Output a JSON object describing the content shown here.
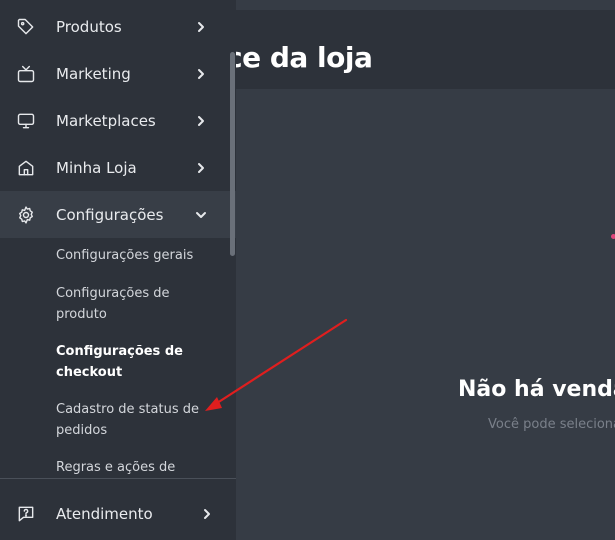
{
  "main": {
    "title": "ce da loja",
    "empty_title": "Não há vendas",
    "empty_subtitle": "Você pode seleciona"
  },
  "sidebar": {
    "items": [
      {
        "label": "Produtos",
        "icon": "tag-icon"
      },
      {
        "label": "Marketing",
        "icon": "tv-icon"
      },
      {
        "label": "Marketplaces",
        "icon": "monitor-icon"
      },
      {
        "label": "Minha Loja",
        "icon": "home-icon"
      },
      {
        "label": "Configurações",
        "icon": "gear-icon",
        "expanded": true
      }
    ],
    "subitems": [
      {
        "label": "Configurações gerais"
      },
      {
        "label": "Configurações de produto"
      },
      {
        "label": "Configurações de checkout",
        "current": true
      },
      {
        "label": "Cadastro de status de pedidos"
      },
      {
        "label": "Regras e ações de"
      }
    ],
    "footer_item": {
      "label": "Atendimento",
      "icon": "help-chat-icon"
    }
  },
  "colors": {
    "sidebar_bg": "#2d323a",
    "main_bg": "#363c45",
    "active_item_bg": "#383e47",
    "annotation_arrow": "#e01e1e",
    "accent_dot": "#e0457a"
  }
}
